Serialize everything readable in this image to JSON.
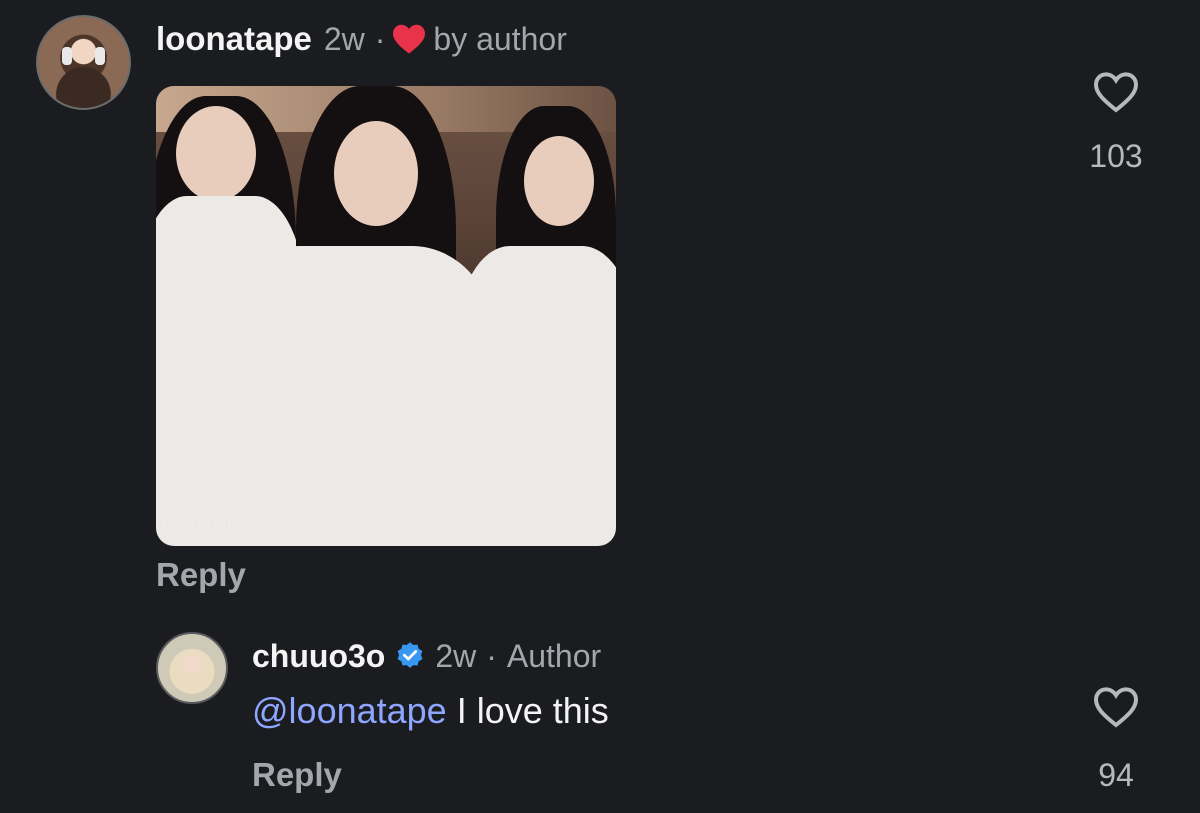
{
  "comment1": {
    "username": "loonatape",
    "time": "2w",
    "separator": "·",
    "liked_by": "by author",
    "media_caption": "loonatape",
    "reply_label": "Reply",
    "like_count": "103"
  },
  "comment2": {
    "username": "chuuo3o",
    "time": "2w",
    "separator": "·",
    "role": "Author",
    "mention": "@loonatape",
    "text": " I love this",
    "reply_label": "Reply",
    "like_count": "94"
  },
  "colors": {
    "background": "#1a1c20",
    "mention": "#8ea6ff",
    "heart_red": "#e8334a",
    "verified_blue": "#3897f0",
    "muted_text": "#a4a6ab"
  },
  "icons": {
    "author_like": "heart-filled-red",
    "like": "heart-outline",
    "verified": "verified-badge"
  }
}
